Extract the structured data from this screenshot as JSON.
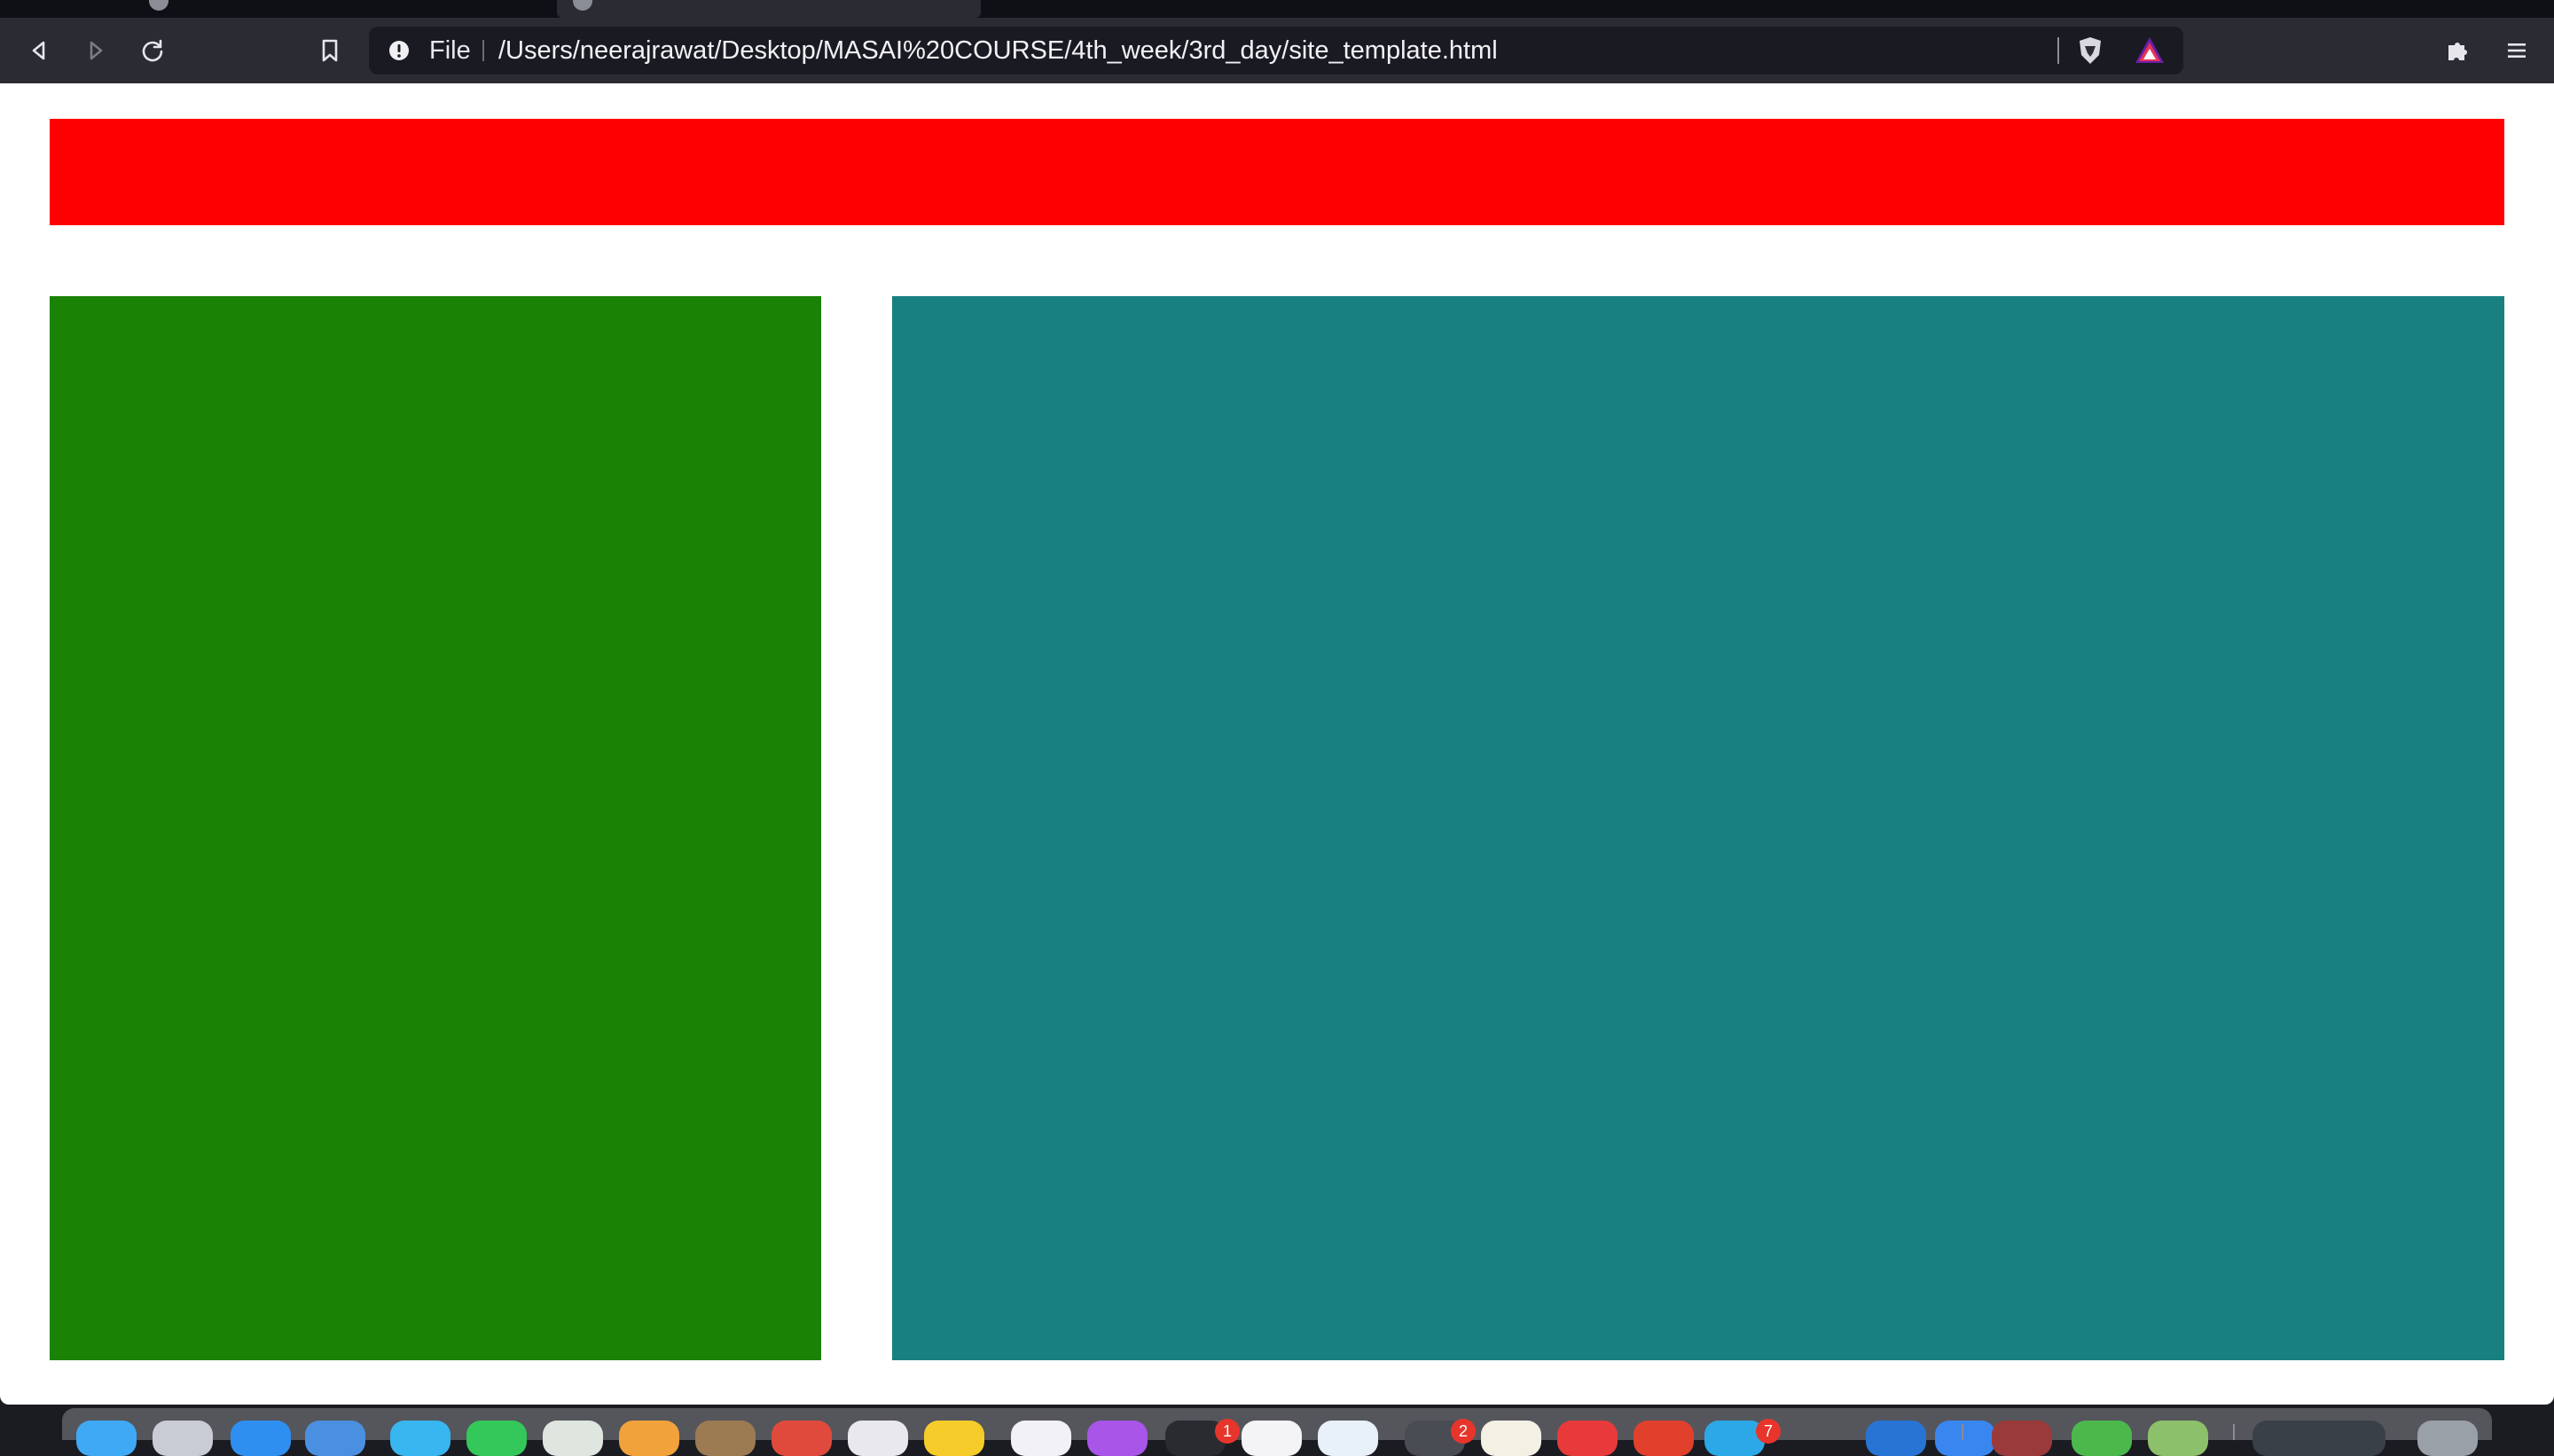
{
  "browser": {
    "toolbar": {
      "back_icon": "back-arrow-icon",
      "forward_icon": "forward-arrow-icon",
      "reload_icon": "reload-icon",
      "bookmark_icon": "bookmark-icon",
      "extensions_icon": "puzzle-icon",
      "menu_icon": "hamburger-menu-icon"
    },
    "address_bar": {
      "info_icon": "info-icon",
      "scheme": "File",
      "url": "/Users/neerajrawat/Desktop/MASAI%20COURSE/4th_week/3rd_day/site_template.html",
      "shield_icon": "brave-shield-icon",
      "rewards_icon": "brave-rewards-icon"
    }
  },
  "page": {
    "header_box_color": "#ff0000",
    "sidebar_box_color": "#1a8205",
    "main_box_color": "#198080"
  },
  "dock": {
    "badges": [
      "1",
      "2",
      "7"
    ]
  }
}
